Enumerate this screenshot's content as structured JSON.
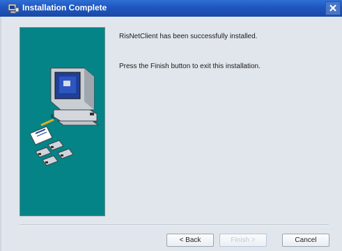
{
  "window": {
    "title": "Installation Complete",
    "close_label": "✕"
  },
  "messages": {
    "line1": "RisNetClient has been successfully installed.",
    "line2": "Press the Finish button to exit this installation."
  },
  "buttons": {
    "back": "< Back",
    "finish": "Finish >",
    "cancel": "Cancel"
  },
  "colors": {
    "titlebar": "#1f56bd",
    "side_panel": "#048486",
    "window_bg": "#e1e6ec"
  },
  "icons": [
    "installer-app-icon",
    "close-icon",
    "computer-illustration",
    "floppy-disk-icon",
    "document-pencil-icon"
  ]
}
